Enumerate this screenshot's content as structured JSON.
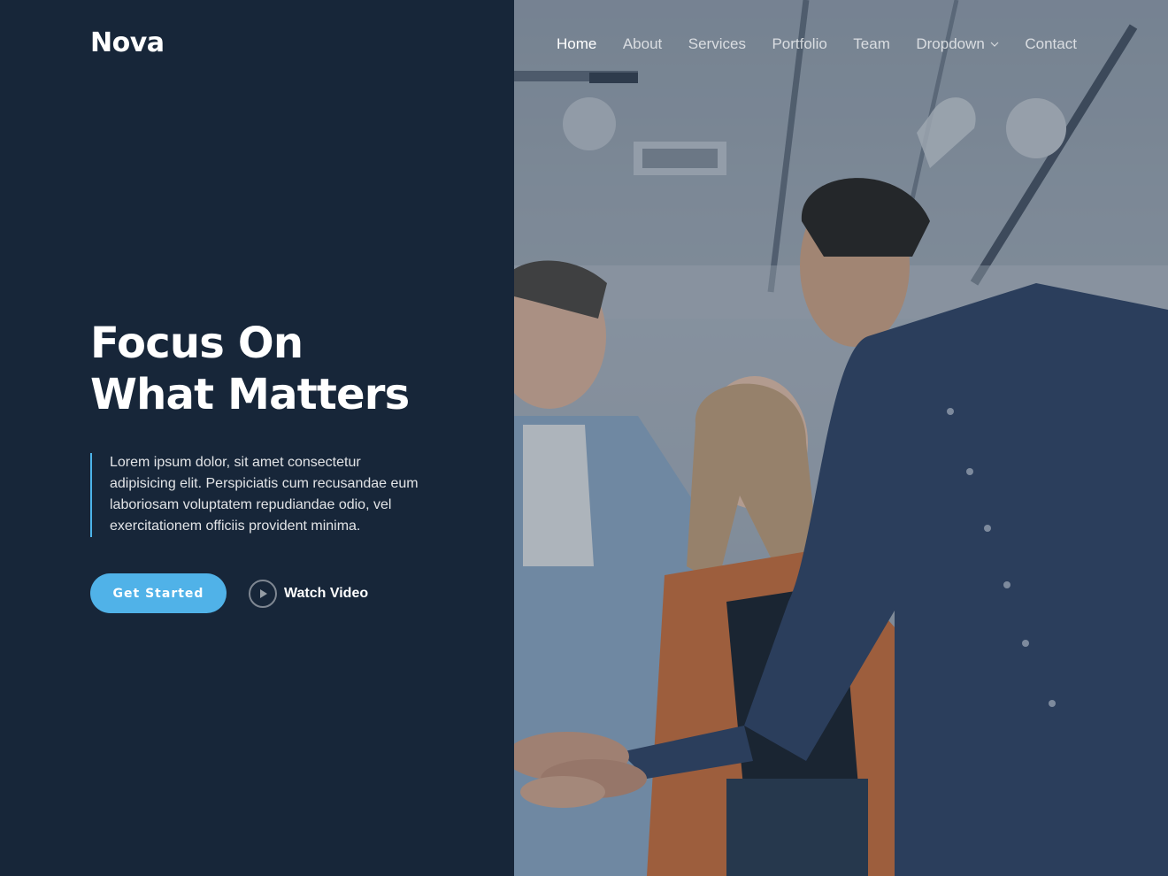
{
  "brand": {
    "logo_text": "Nova"
  },
  "nav": {
    "items": [
      {
        "label": "Home",
        "active": true
      },
      {
        "label": "About"
      },
      {
        "label": "Services"
      },
      {
        "label": "Portfolio"
      },
      {
        "label": "Team"
      },
      {
        "label": "Dropdown",
        "has_dropdown": true
      },
      {
        "label": "Contact"
      }
    ]
  },
  "hero": {
    "headline_line1": "Focus On",
    "headline_line2": "What Matters",
    "intro_text": "Lorem ipsum dolor, sit amet consectetur adipisicing elit. Perspiciatis cum recusandae eum laboriosam voluptatem repudiandae odio, vel exercitationem officiis provident minima.",
    "cta_label": "Get Started",
    "video_label": "Watch Video",
    "image_icon": "team-hands-together-photo",
    "play_icon": "play-icon"
  },
  "colors": {
    "panel_bg": "#172639",
    "accent": "#50b2e8",
    "text": "#ffffff"
  }
}
